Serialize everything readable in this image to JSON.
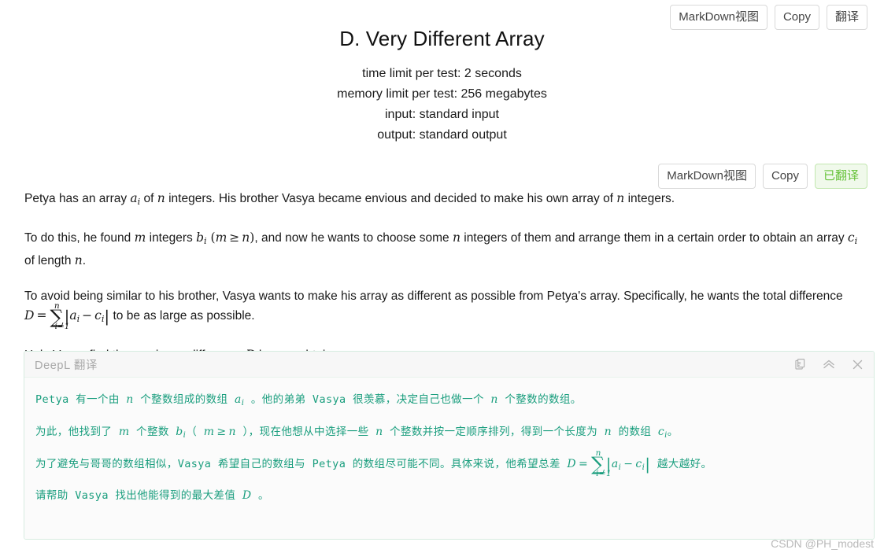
{
  "toolbar_top": {
    "buttons": [
      {
        "label": "MarkDown视图",
        "name": "markdown-view-button",
        "style": "plain"
      },
      {
        "label": "Copy",
        "name": "copy-button",
        "style": "plain"
      },
      {
        "label": "翻译",
        "name": "translate-button",
        "style": "plain"
      }
    ]
  },
  "toolbar_statement": {
    "buttons": [
      {
        "label": "MarkDown视图",
        "name": "markdown-view-button",
        "style": "plain"
      },
      {
        "label": "Copy",
        "name": "copy-button",
        "style": "plain"
      },
      {
        "label": "已翻译",
        "name": "translated-button",
        "style": "green"
      }
    ]
  },
  "header": {
    "title": "D. Very Different Array",
    "time_limit": "time limit per test: 2 seconds",
    "memory_limit": "memory limit per test: 256 megabytes",
    "input": "input: standard input",
    "output": "output: standard output"
  },
  "statement": {
    "p1_a": "Petya has an array ",
    "p1_b": " of ",
    "p1_c": " integers. His brother Vasya became envious and decided to make his own array of ",
    "p1_d": " integers.",
    "p2_a": "To do this, he found ",
    "p2_b": " integers ",
    "p2_c": ", and now he wants to choose some ",
    "p2_d": " integers of them and arrange them in a certain order to obtain an array ",
    "p2_e": " of length ",
    "p2_f": ".",
    "p3_a": "To avoid being similar to his brother, Vasya wants to make his array as different as possible from Petya's array. Specifically, he wants the total difference ",
    "p3_b": " to be as large as possible.",
    "p4_a": "Help Vasya find the maximum difference ",
    "p4_b": " he can obtain.",
    "sym": {
      "a": "a",
      "b": "b",
      "c": "c",
      "i": "i",
      "n": "n",
      "m": "m",
      "D": "D",
      "eq": "=",
      "ge": "≥",
      "minus": "−",
      "sum": "∑",
      "lower": "i=1",
      "lparen": "(",
      "rparen": ")",
      "bar": "|"
    }
  },
  "deepl": {
    "title": "DeepL 翻译",
    "actions": [
      {
        "name": "copy-icon",
        "title": "copy"
      },
      {
        "name": "chevron-up-icon",
        "title": "collapse"
      },
      {
        "name": "close-icon",
        "title": "close"
      }
    ],
    "zh1_a": "Petya 有一个由 ",
    "zh1_b": " 个整数组成的数组 ",
    "zh1_c": " 。他的弟弟 Vasya 很羡慕，决定自己也做一个 ",
    "zh1_d": " 个整数的数组。",
    "zh2_a": "为此，他找到了 ",
    "zh2_b": " 个整数 ",
    "zh2_c": "（ ",
    "zh2_d": " ），现在他想从中选择一些 ",
    "zh2_e": " 个整数并按一定顺序排列，得到一个长度为 ",
    "zh2_f": " 的数组 ",
    "zh2_g": "。",
    "zh3_a": "为了避免与哥哥的数组相似，Vasya 希望自己的数组与 Petya 的数组尽可能不同。具体来说，他希望总差 ",
    "zh3_b": " 越大越好。",
    "zh4_a": "请帮助 Vasya 找出他能得到的最大差值 ",
    "zh4_b": " 。"
  },
  "watermark": "CSDN @PH_modest",
  "colors": {
    "accent_green": "#1a9e7e",
    "button_green_text": "#67c23a",
    "button_green_bg": "#f0f9eb",
    "button_green_border": "#c2e7b0",
    "panel_border": "#d6ece0",
    "text": "#1a1a1a"
  }
}
